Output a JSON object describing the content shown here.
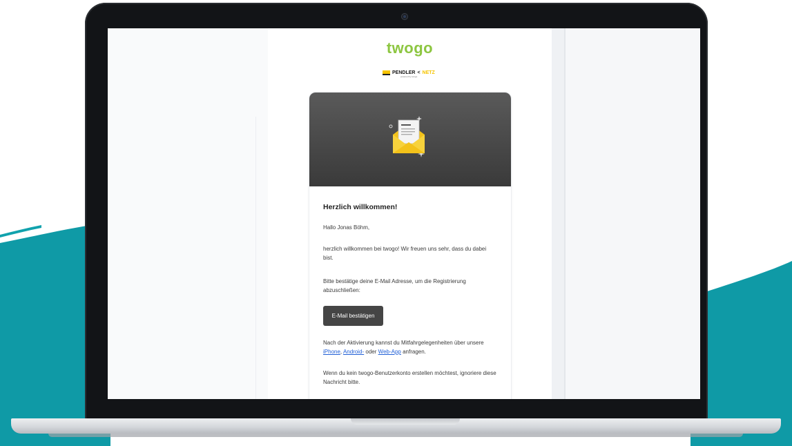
{
  "colors": {
    "teal": "#0f9aa6",
    "logo_green": "#8dc641",
    "pendler_yellow": "#f6c400",
    "hero_dark": "#3a3a3a",
    "button_bg": "#454545",
    "link": "#1f5ed6"
  },
  "email": {
    "logo": "twogo",
    "partner_logo": {
      "word1": "PENDLER",
      "arrow": "<",
      "word2": "NETZ",
      "sub": "powered by twogo"
    },
    "hero_icon": "envelope-with-letter-icon",
    "heading": "Herzlich willkommen!",
    "greeting": "Hallo Jonas Böhm,",
    "intro": "herzlich willkommen bei twogo! Wir freuen uns sehr, dass du dabei bist.",
    "confirm_text": "Bitte bestätige deine E-Mail Adresse, um die Registrierung abzuschließen:",
    "button_label": "E-Mail bestätigen",
    "after_prefix": "Nach der Aktivierung kannst du Mitfahrgelegenheiten über unsere",
    "link_iphone": "iPhone",
    "sep1": ", ",
    "link_android": "Android-",
    "mid": " oder ",
    "link_webapp": "Web-App",
    "after_suffix": " anfragen.",
    "ignore_text": "Wenn du kein twogo-Benutzerkonto erstellen möchtest, ignoriere diese Nachricht bitte."
  }
}
